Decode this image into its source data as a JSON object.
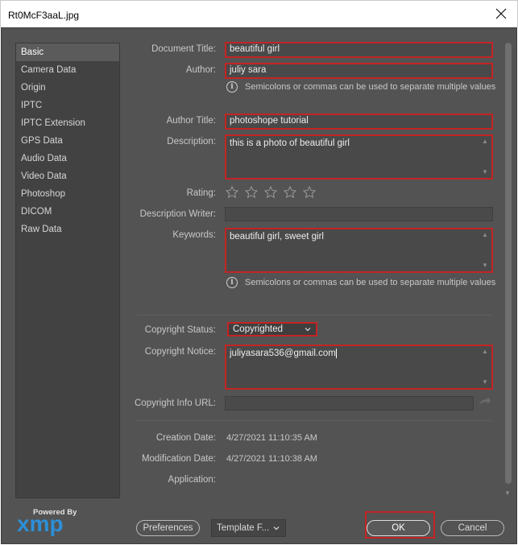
{
  "window": {
    "title": "Rt0McF3aaL.jpg"
  },
  "sidebar": {
    "items": [
      {
        "label": "Basic",
        "active": true
      },
      {
        "label": "Camera Data"
      },
      {
        "label": "Origin"
      },
      {
        "label": "IPTC"
      },
      {
        "label": "IPTC Extension"
      },
      {
        "label": "GPS Data"
      },
      {
        "label": "Audio Data"
      },
      {
        "label": "Video Data"
      },
      {
        "label": "Photoshop"
      },
      {
        "label": "DICOM"
      },
      {
        "label": "Raw Data"
      }
    ]
  },
  "branding": {
    "powered_by": "Powered By",
    "logo": "xmp"
  },
  "form": {
    "document_title": {
      "label": "Document Title:",
      "value": "beautiful girl"
    },
    "author": {
      "label": "Author:",
      "value": "juliy sara"
    },
    "author_hint": "Semicolons or commas can be used to separate multiple values",
    "author_title": {
      "label": "Author Title:",
      "value": "photoshope tutorial"
    },
    "description": {
      "label": "Description:",
      "value": "this is a photo of beautiful girl"
    },
    "rating": {
      "label": "Rating:",
      "stars": 0,
      "max": 5
    },
    "description_writer": {
      "label": "Description Writer:",
      "value": ""
    },
    "keywords": {
      "label": "Keywords:",
      "value": "beautiful girl, sweet girl"
    },
    "keywords_hint": "Semicolons or commas can be used to separate multiple values",
    "copyright_status": {
      "label": "Copyright Status:",
      "value": "Copyrighted"
    },
    "copyright_notice": {
      "label": "Copyright Notice:",
      "value": "juliyasara536@gmail.com"
    },
    "copyright_url": {
      "label": "Copyright Info URL:",
      "value": ""
    },
    "creation_date": {
      "label": "Creation Date:",
      "value": "4/27/2021 11:10:35 AM"
    },
    "modification_date": {
      "label": "Modification Date:",
      "value": "4/27/2021 11:10:38 AM"
    },
    "application": {
      "label": "Application:",
      "value": ""
    }
  },
  "footer": {
    "preferences": "Preferences",
    "template": "Template F...",
    "ok": "OK",
    "cancel": "Cancel"
  },
  "colors": {
    "highlight": "#c42424",
    "panel": "#535353",
    "xmp_blue": "#2d8fd7"
  }
}
